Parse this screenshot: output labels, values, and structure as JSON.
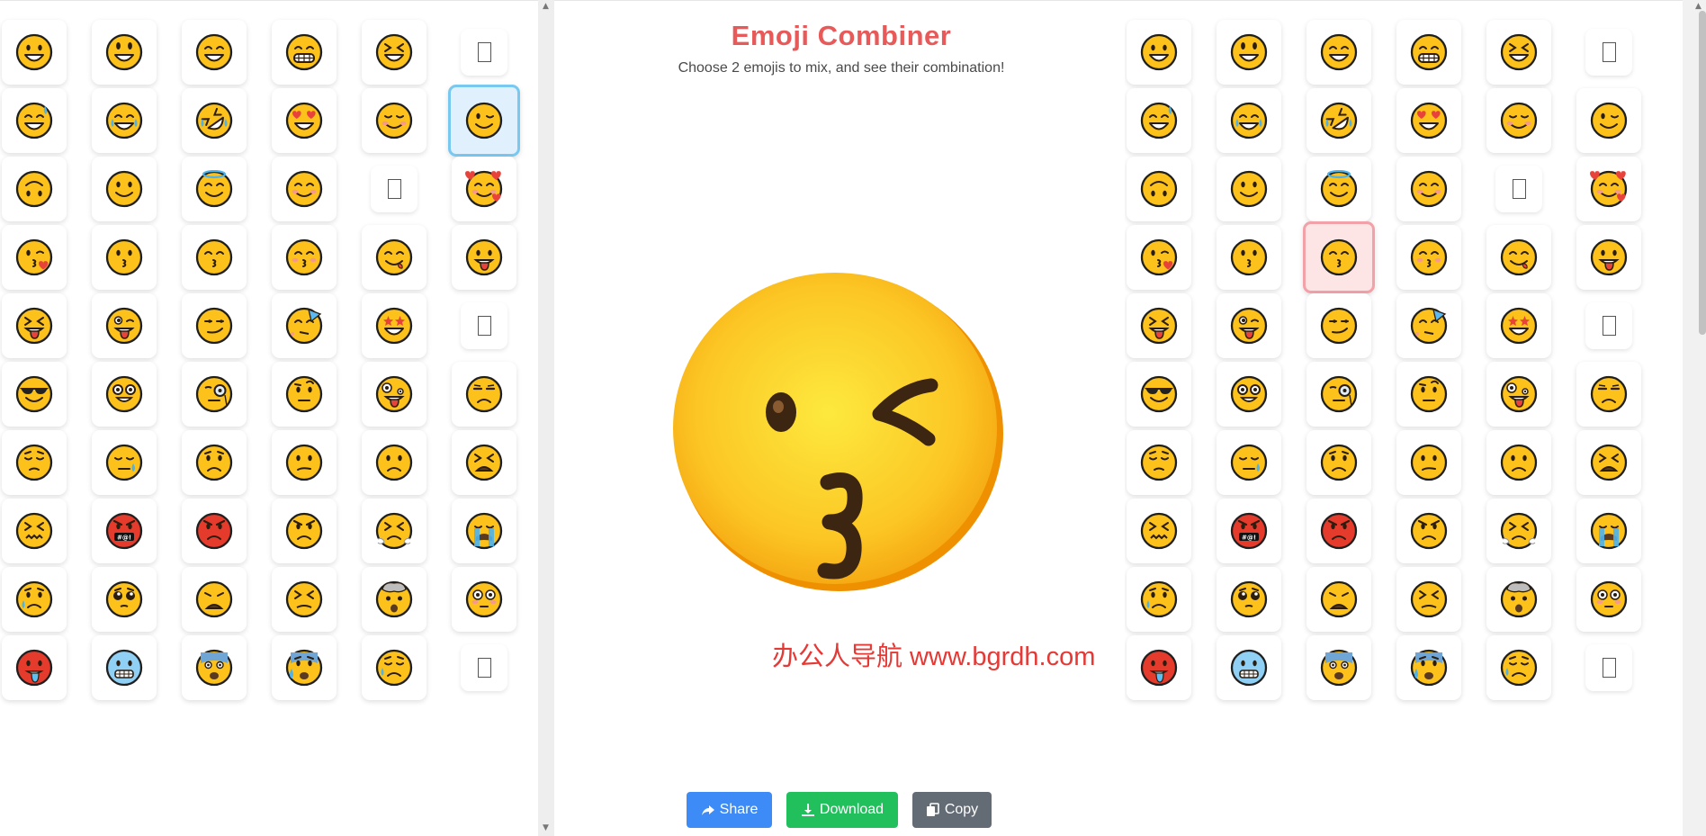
{
  "header": {
    "title": "Emoji Combiner",
    "subtitle": "Choose 2 emojis to mix, and see their combination!"
  },
  "colors": {
    "accent_left": "#79c8f0",
    "accent_right": "#f2a1a8",
    "share": "#3d8bf6",
    "download": "#22c05d",
    "copy": "#636b75"
  },
  "left_grid": {
    "selected": "winking-face",
    "emojis": [
      "grinning-face",
      "grinning-face-big-eyes",
      "grinning-face-smiling-eyes",
      "beaming-face",
      "grinning-squinting-face",
      "unsupported-glyph",
      "grinning-face-with-sweat",
      "face-with-tears-of-joy",
      "rolling-on-floor-laughing",
      "smiling-face-heart-eyes",
      "relieved-face",
      "winking-face",
      "upside-down-face",
      "slightly-smiling-face",
      "smiling-face-with-halo",
      "smiling-face-smiling-eyes",
      "unsupported-glyph",
      "smiling-face-with-hearts",
      "face-blowing-kiss",
      "kissing-face",
      "kissing-face-closed-eyes",
      "kissing-face-smiling-eyes",
      "face-savoring-food",
      "face-with-tongue",
      "squinting-face-with-tongue",
      "winking-face-with-tongue",
      "smirking-face",
      "partying-face",
      "star-struck",
      "unsupported-glyph",
      "smiling-face-with-sunglasses",
      "nerd-face",
      "face-with-monocle",
      "face-with-raised-eyebrow",
      "zany-face",
      "unamused-face",
      "pensive-face",
      "sleepy-face",
      "worried-face",
      "confused-face",
      "slightly-frowning-face",
      "tired-face",
      "confounded-face",
      "face-with-symbols-on-mouth",
      "pouting-face",
      "angry-face",
      "face-with-steam",
      "loudly-crying-face",
      "crying-face",
      "pleading-face",
      "weary-face",
      "persevering-face",
      "exploding-head",
      "flushed-face",
      "hot-face",
      "cold-face",
      "fearful-face",
      "anxious-face-with-sweat",
      "sad-relieved-face",
      "unsupported-glyph"
    ]
  },
  "right_grid": {
    "selected": "kissing-face-closed-eyes",
    "emojis": [
      "grinning-face",
      "grinning-face-big-eyes",
      "grinning-face-smiling-eyes",
      "beaming-face",
      "grinning-squinting-face",
      "unsupported-glyph",
      "grinning-face-with-sweat",
      "face-with-tears-of-joy",
      "rolling-on-floor-laughing",
      "smiling-face-heart-eyes",
      "relieved-face",
      "winking-face",
      "upside-down-face",
      "slightly-smiling-face",
      "smiling-face-with-halo",
      "smiling-face-smiling-eyes",
      "unsupported-glyph",
      "smiling-face-with-hearts",
      "face-blowing-kiss",
      "kissing-face",
      "kissing-face-closed-eyes",
      "kissing-face-smiling-eyes",
      "face-savoring-food",
      "face-with-tongue",
      "squinting-face-with-tongue",
      "winking-face-with-tongue",
      "smirking-face",
      "partying-face",
      "star-struck",
      "unsupported-glyph",
      "smiling-face-with-sunglasses",
      "nerd-face",
      "face-with-monocle",
      "face-with-raised-eyebrow",
      "zany-face",
      "unamused-face",
      "pensive-face",
      "sleepy-face",
      "worried-face",
      "confused-face",
      "slightly-frowning-face",
      "tired-face",
      "confounded-face",
      "face-with-symbols-on-mouth",
      "pouting-face",
      "angry-face",
      "face-with-steam",
      "loudly-crying-face",
      "crying-face",
      "pleading-face",
      "weary-face",
      "persevering-face",
      "exploding-head",
      "flushed-face",
      "hot-face",
      "cold-face",
      "fearful-face",
      "anxious-face-with-sweat",
      "sad-relieved-face",
      "unsupported-glyph"
    ]
  },
  "result": {
    "emoji": "winking-kissing-face"
  },
  "symbol_text": "#@!",
  "watermark": "办公人导航 www.bgrdh.com",
  "actions": {
    "share_label": "Share",
    "download_label": "Download",
    "copy_label": "Copy"
  }
}
